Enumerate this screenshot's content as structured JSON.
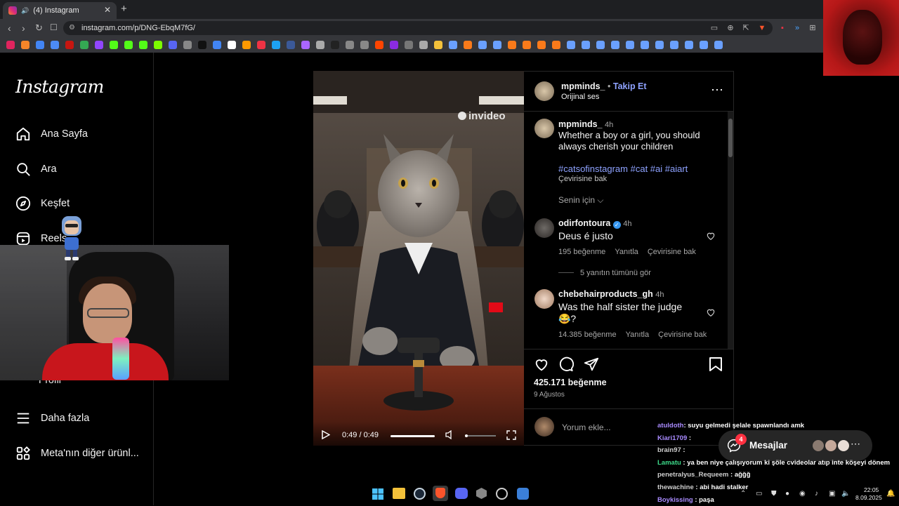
{
  "browser": {
    "tab_title": "(4) Instagram",
    "url": "instagram.com/p/DNG-EbqM7fG/"
  },
  "sidebar": {
    "logo": "Instagram",
    "items": [
      {
        "label": "Ana Sayfa",
        "icon": "home-icon"
      },
      {
        "label": "Ara",
        "icon": "search-icon"
      },
      {
        "label": "Keşfet",
        "icon": "compass-icon"
      },
      {
        "label": "Reels",
        "icon": "reels-icon"
      },
      {
        "label": "Profil",
        "icon": "profile-icon"
      },
      {
        "label": "Daha fazla",
        "icon": "menu-icon"
      },
      {
        "label": "Meta'nın diğer ürünl...",
        "icon": "meta-apps-icon"
      }
    ]
  },
  "post": {
    "username": "mpminds_",
    "follow_label": "Takip Et",
    "audio": "Orijinal ses",
    "watermark": "invideo",
    "video_time": "0:49 / 0:49",
    "caption": {
      "username": "mpminds_",
      "time": "4h",
      "text": "Whether a boy or a girl, you should always cherish your children",
      "hashtags": "#catsofinstagram #cat #ai #aiart",
      "translate": "Çevirisine bak"
    },
    "sort_label": "Senin için",
    "comments": [
      {
        "username": "odirfontoura",
        "time": "4h",
        "text": "Deus é justo",
        "likes": "195 beğenme",
        "reply": "Yanıtla",
        "translate": "Çevirisine bak",
        "view_replies": "5 yanıtın tümünü gör"
      },
      {
        "username": "chebehairproducts_gh",
        "time": "4h",
        "text": "Was the half sister the judge 😂?",
        "likes": "14.385 beğenme",
        "reply": "Yanıtla",
        "translate": "Çevirisine bak"
      }
    ],
    "likes_total": "425.171 beğenme",
    "date": "9 Ağustos",
    "comment_placeholder": "Yorum ekle..."
  },
  "messages": {
    "label": "Mesajlar",
    "badge": "4"
  },
  "chat": [
    {
      "user": "atuldoth",
      "color": "#a98bff",
      "text": ": suyu gelmedi şelale spawnlandı amk"
    },
    {
      "user": "Kiari1709",
      "color": "#a98bff",
      "text": " :"
    },
    {
      "user": "brain97",
      "color": "#cfcfcf",
      "text": " :"
    },
    {
      "user": "Lamatu",
      "color": "#3ddb8a",
      "text": " : ya ben niye çalışıyorum ki şöle cvideolar atıp inte köşeyi dönem"
    },
    {
      "user": "penetralyus_Requeem",
      "color": "#cfcfcf",
      "text": " : ağğğ"
    },
    {
      "user": "thewachine",
      "color": "#cfcfcf",
      "text": " : abi hadi stalker"
    },
    {
      "user": "Boykissing",
      "color": "#a98bff",
      "text": " : paşa"
    }
  ],
  "tray": {
    "time": "22:05",
    "date": "8.09.2025"
  },
  "colors": {
    "accent_link": "#8ea2ff",
    "follow": "#8ea2ff",
    "badge": "#ff3040"
  }
}
